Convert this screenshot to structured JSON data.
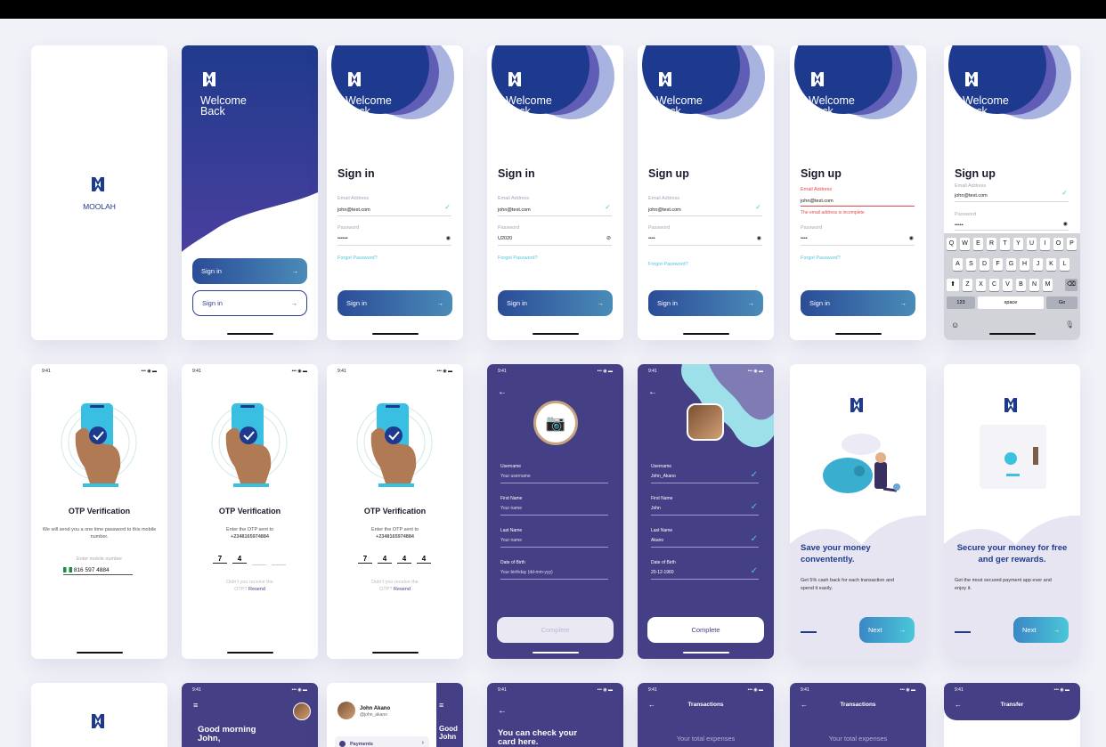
{
  "colors": {
    "navy": "#1e3a8e",
    "purple": "#453f85",
    "accent": "#4ac7d8",
    "error": "#e24b4b"
  },
  "brand": {
    "name": "MOOLAH"
  },
  "auth": {
    "welcome_line1": "Welcome",
    "welcome_line2": "Back",
    "sign_in_title": "Sign in",
    "sign_up_title": "Sign up",
    "email_label": "Email Address",
    "email_value": "john@test.com",
    "password_label": "Password",
    "password_masked": "••••••",
    "password_revealed": "U2020",
    "password_short": "••••",
    "password_keyboard": "•••••",
    "forgot": "Forgot Password?",
    "sign_in_button": "Sign in",
    "error_text": "The email address is incomplete"
  },
  "keyboard": {
    "row1": [
      "Q",
      "W",
      "E",
      "R",
      "T",
      "Y",
      "U",
      "I",
      "O",
      "P"
    ],
    "row2": [
      "A",
      "S",
      "D",
      "F",
      "G",
      "H",
      "J",
      "K",
      "L"
    ],
    "row3": [
      "Z",
      "X",
      "C",
      "V",
      "B",
      "N",
      "M"
    ],
    "num": "123",
    "space": "space",
    "go": "Go"
  },
  "status": {
    "time": "9:41",
    "icons": "••• ◉ ▬"
  },
  "otp": {
    "title": "OTP Verification",
    "intro": "We will send you a one time password to this mobile number.",
    "enter_mobile": "Enter mobile number",
    "phone": "816 597 4884",
    "sent_line1": "Enter the OTP sent to",
    "sent_phone": "+2348165974884",
    "digits_partial": [
      "7",
      "4",
      "",
      ""
    ],
    "digits_full": [
      "7",
      "4",
      "4",
      "4"
    ],
    "resend_prefix": "Didn't you receive the",
    "resend_otp": "OTP?",
    "resend_link": "Resend"
  },
  "profile": {
    "username_label": "Username",
    "username_placeholder": "Your username",
    "username_value": "John_Akano",
    "first_label": "First Name",
    "first_placeholder": "Your name",
    "first_value": "John",
    "last_label": "Last Name",
    "last_placeholder": "Your name",
    "last_value": "Akano",
    "dob_label": "Date of Birth",
    "dob_placeholder": "Your birthday (dd-mm-yyy)",
    "dob_value": "20-12-1960",
    "complete": "Complete"
  },
  "onboarding": {
    "slide1_title": "Save your money conventently.",
    "slide1_text": "Get 5% cash back for each transaction and spend it easily.",
    "slide2_title": "Secure your money for free and ger rewards.",
    "slide2_text": "Get the most secured payment app ever and enjoy it.",
    "next": "Next"
  },
  "dashboard": {
    "greeting_line1": "Good morning",
    "greeting_line2": "John,",
    "menu_name": "John Akano",
    "menu_handle": "@john_akano",
    "menu_payments": "Payments",
    "peek_line1": "Good",
    "peek_line2": "John",
    "card_line1": "You can check your",
    "card_line2": "card here.",
    "transactions_title": "Transactions",
    "total_expenses": "Your total expenses",
    "transfer_title": "Transfer"
  }
}
